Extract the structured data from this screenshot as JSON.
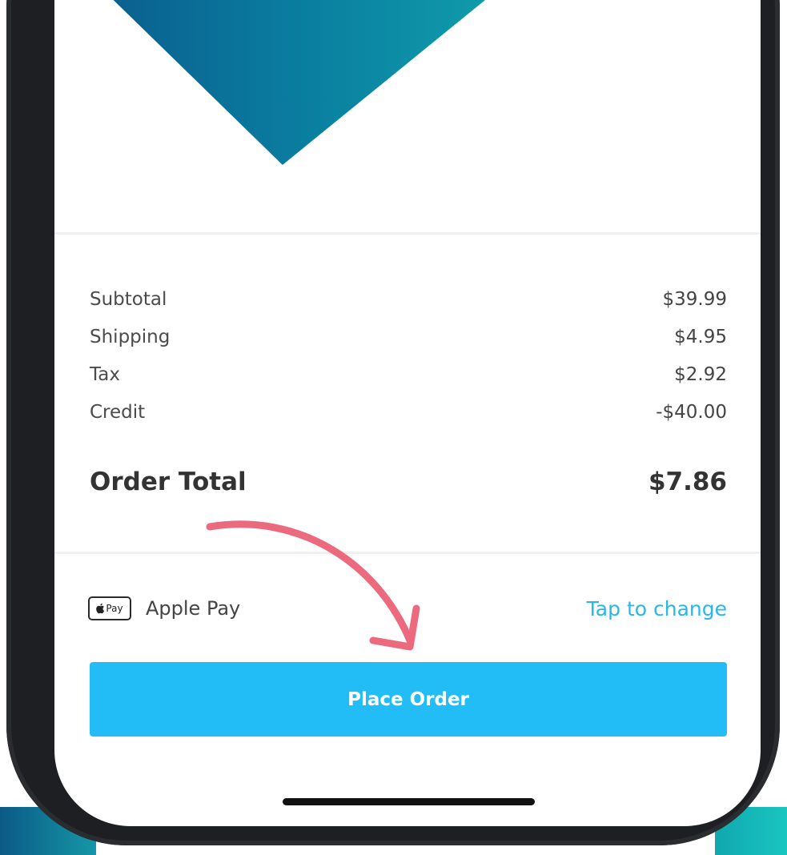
{
  "summary": {
    "rows": [
      {
        "label": "Subtotal",
        "value": "$39.99"
      },
      {
        "label": "Shipping",
        "value": "$4.95"
      },
      {
        "label": "Tax",
        "value": "$2.92"
      },
      {
        "label": "Credit",
        "value": "-$40.00"
      }
    ],
    "total_label": "Order Total",
    "total_value": "$7.86"
  },
  "payment": {
    "logo_text": "Pay",
    "method": "Apple Pay",
    "change_link": "Tap to change"
  },
  "place_order_label": "Place Order",
  "colors": {
    "accent": "#22bdf6",
    "link": "#27b7ec",
    "arrow": "#ec6a7d",
    "banner_start": "#0b4f86",
    "banner_end": "#14b0b3"
  }
}
